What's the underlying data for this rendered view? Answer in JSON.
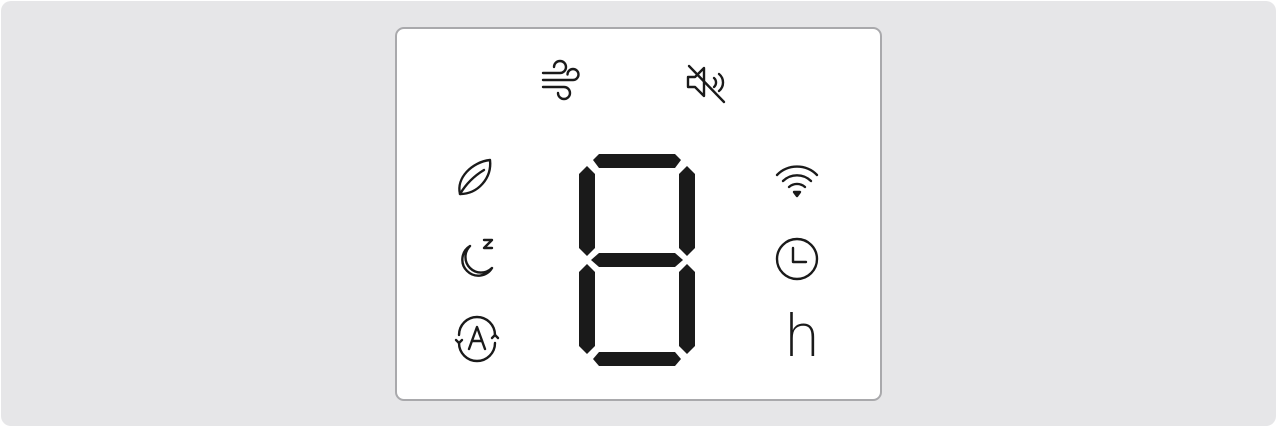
{
  "display": {
    "digit_value": "8",
    "unit_label": "h",
    "color": "#1a1a1a"
  },
  "icons": {
    "top": [
      "fan-wind-icon",
      "mute-icon"
    ],
    "left": [
      "eco-leaf-icon",
      "sleep-moon-icon",
      "auto-mode-icon"
    ],
    "right": [
      "wifi-icon",
      "clock-timer-icon",
      "hours-unit-label"
    ]
  }
}
